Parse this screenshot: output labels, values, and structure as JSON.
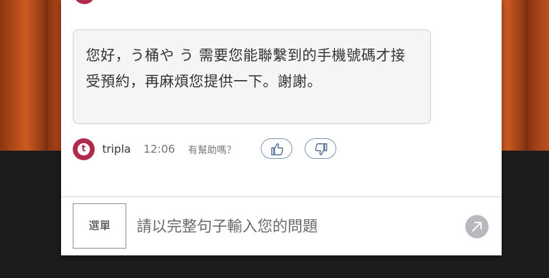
{
  "chat": {
    "message": "您好，う桶や う 需要您能聯繫到的手機號碼才接受預約，再麻煩您提供一下。謝謝。",
    "sender": "tripla",
    "time": "12:06",
    "helpful_prompt": "有幫助嗎？",
    "avatar_letter": "t"
  },
  "composer": {
    "menu_label": "選單",
    "placeholder": "請以完整句子輸入您的問題"
  },
  "icons": {
    "thumb_up": "thumbs-up-icon",
    "thumb_down": "thumbs-down-icon",
    "send": "send-arrow-icon"
  },
  "colors": {
    "brand": "#b2294e",
    "thumb_border": "#7a8fb0",
    "send_bg": "#b7b9be"
  }
}
